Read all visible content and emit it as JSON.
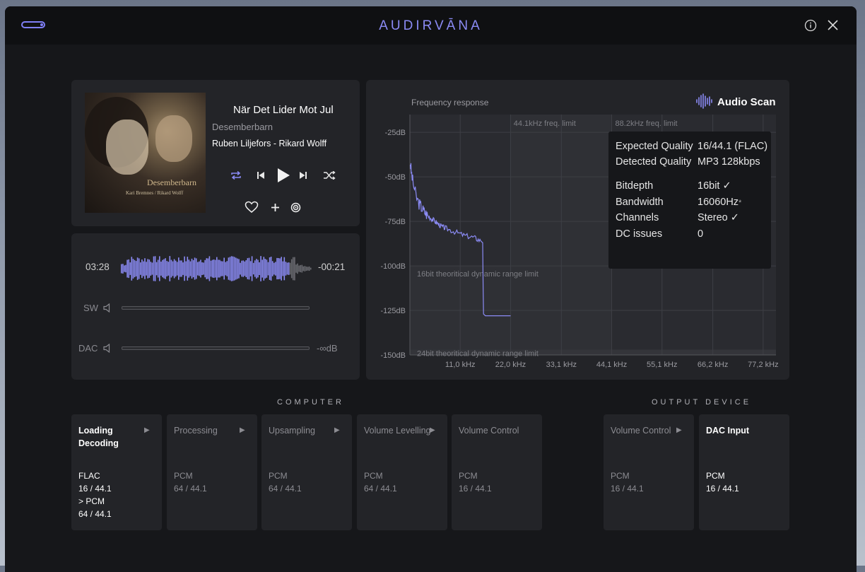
{
  "app": {
    "title": "AUDIRVĀNA"
  },
  "track": {
    "title": "När Det Lider Mot Jul",
    "album": "Desemberbarn",
    "artist": "Ruben Liljefors - Rikard Wolff",
    "cover_title": "Desemberbarn",
    "cover_subtitle": "Kari Bremnes / Rikard Wolff"
  },
  "playback": {
    "elapsed": "03:28",
    "remaining": "-00:21",
    "progress": 0.88
  },
  "levels": {
    "sw_label": "SW",
    "dac_label": "DAC",
    "dac_value": "-∞dB"
  },
  "audio_scan": {
    "heading": "Audio Scan",
    "chart_title": "Frequency response",
    "expected_label": "Expected Quality",
    "expected_value": "16/44.1 (FLAC)",
    "detected_label": "Detected Quality",
    "detected_value": "MP3 128kbps",
    "bitdepth_label": "Bitdepth",
    "bitdepth_value": "16bit ✓",
    "bandwidth_label": "Bandwidth",
    "bandwidth_value": "16060Hz",
    "bandwidth_mark": "*",
    "channels_label": "Channels",
    "channels_value": "Stereo ✓",
    "dc_label": "DC issues",
    "dc_value": "0"
  },
  "chart_data": {
    "type": "line",
    "title": "Frequency response",
    "xlabel": "",
    "ylabel": "",
    "x_unit": "kHz",
    "xlim": [
      0,
      80
    ],
    "ylim": [
      -150,
      -15
    ],
    "x_ticks": [
      "11,0 kHz",
      "22,0 kHz",
      "33,1 kHz",
      "44,1 kHz",
      "55,1 kHz",
      "66,2 kHz",
      "77,2 kHz"
    ],
    "x_tick_values": [
      11.0,
      22.0,
      33.1,
      44.1,
      55.1,
      66.2,
      77.2
    ],
    "y_ticks": [
      "-25dB",
      "-50dB",
      "-75dB",
      "-100dB",
      "-125dB",
      "-150dB"
    ],
    "y_tick_values": [
      -25,
      -50,
      -75,
      -100,
      -125,
      -150
    ],
    "annotations": [
      {
        "text": "44.1kHz freq. limit"
      },
      {
        "text": "88.2kHz freq. limit"
      },
      {
        "text": "16bit theoritical dynamic range limit"
      },
      {
        "text": "24bit theoritical dynamic range limit"
      }
    ],
    "series": [
      {
        "x": [
          0.1,
          0.3,
          0.6,
          1.0,
          1.5,
          2.0,
          3.0,
          4.0,
          5.0,
          6.0,
          7.0,
          8.0,
          10.0,
          12.0,
          14.0,
          15.5,
          15.9,
          16.0,
          16.1,
          16.5,
          18.0,
          20.0,
          22.0
        ],
        "y": [
          -42,
          -47,
          -52,
          -57,
          -62,
          -65,
          -69,
          -72,
          -74,
          -76,
          -78,
          -79,
          -81,
          -83,
          -84,
          -86,
          -87,
          -110,
          -127,
          -128,
          -128,
          -128,
          -128
        ]
      }
    ],
    "grid": true,
    "legend": "none"
  },
  "pipeline": {
    "computer_label": "COMPUTER",
    "output_label": "OUTPUT DEVICE",
    "stages": [
      {
        "name": "Loading\nDecoding",
        "format": "FLAC\n16 / 44.1\n> PCM\n64 / 44.1",
        "arrow": "▶"
      },
      {
        "name": "Processing",
        "format": "PCM\n64 / 44.1",
        "arrow": "▶"
      },
      {
        "name": "Upsampling",
        "format": "PCM\n64 / 44.1",
        "arrow": "▶"
      },
      {
        "name": "Volume Levelling",
        "format": "PCM\n64 / 44.1",
        "arrow": "▶"
      },
      {
        "name": "Volume Control",
        "format": "PCM\n16 / 44.1"
      },
      {
        "name": "Volume Control",
        "format": "PCM\n16 / 44.1",
        "arrow": "▶"
      },
      {
        "name": "DAC Input",
        "format": "PCM\n16 / 44.1"
      }
    ]
  }
}
